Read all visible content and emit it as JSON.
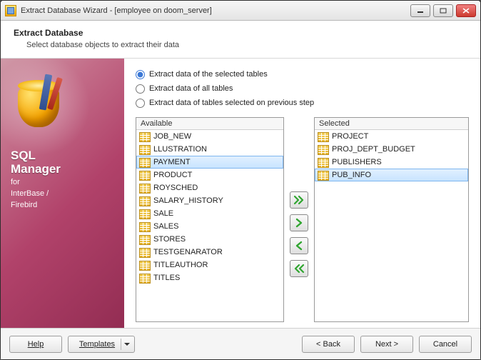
{
  "window": {
    "title": "Extract Database Wizard - [employee on doom_server]"
  },
  "header": {
    "title": "Extract Database",
    "subtitle": "Select database objects to extract their data"
  },
  "sidebar": {
    "product_line1": "SQL",
    "product_line2": "Manager",
    "for_line1": "for",
    "for_line2": "InterBase /",
    "for_line3": "Firebird"
  },
  "options": {
    "opt1": "Extract data of the selected tables",
    "opt2": "Extract data of all tables",
    "opt3": "Extract data of tables selected on  previous step",
    "selected_index": 0
  },
  "lists": {
    "available_label": "Available",
    "selected_label": "Selected",
    "available": [
      "JOB_NEW",
      "LLUSTRATION",
      "PAYMENT",
      "PRODUCT",
      "ROYSCHED",
      "SALARY_HISTORY",
      "SALE",
      "SALES",
      "STORES",
      "TESTGENARATOR",
      "TITLEAUTHOR",
      "TITLES"
    ],
    "available_highlight_index": 2,
    "selected": [
      "PROJECT",
      "PROJ_DEPT_BUDGET",
      "PUBLISHERS",
      "PUB_INFO"
    ],
    "selected_highlight_index": 3
  },
  "footer": {
    "help": "Help",
    "templates": "Templates",
    "back": "< Back",
    "next": "Next >",
    "cancel": "Cancel"
  },
  "colors": {
    "accent_green": "#2fa52f",
    "sidebar_from": "#c36c88",
    "sidebar_to": "#932d53"
  }
}
